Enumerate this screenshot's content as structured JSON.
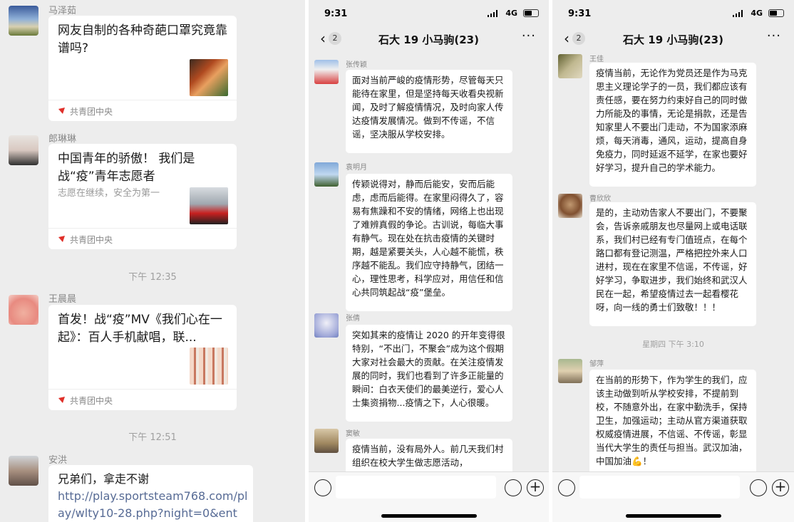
{
  "panel1": {
    "messages": [
      {
        "sender": "马泽茹",
        "title": "网友自制的各种奇葩口罩究竟靠谱吗?",
        "subtitle": "",
        "source": "共青团中央"
      },
      {
        "sender": "郎琳琳",
        "title": "中国青年的骄傲！ 我们是战“疫”青年志愿者",
        "subtitle": "志愿在继续，安全为第一",
        "source": "共青团中央"
      },
      {
        "sender": "王晨晨",
        "title": "首发！战“疫”MV《我们心在一起》：百人手机献唱，联...",
        "subtitle": "",
        "source": "共青团中央"
      }
    ],
    "timestamps": [
      "下午 12:35",
      "下午 12:51"
    ],
    "last": {
      "sender": "安洪",
      "text": "兄弟们，拿走不谢",
      "url": "http://play.sportsteam768.com/play/wlty10-28.php?night=0&ent"
    }
  },
  "phone": {
    "time": "9:31",
    "network": "4G",
    "title": "石大 19 小马驹(23)",
    "badge": "2",
    "more": "···"
  },
  "panel2": {
    "messages": [
      {
        "name": "张传颖",
        "text": "面对当前严峻的疫情形势，尽管每天只能待在家里，但是坚持每天收看央视新闻，及时了解疫情情况，及时向家人传达疫情发展情况。做到不传谣，不信谣，坚决服从学校安排。"
      },
      {
        "name": "袁明月",
        "text": "传颖说得对，静而后能安，安而后能虑，虑而后能得。在家里闷得久了，容易有焦躁和不安的情绪，网络上也出现了难辨真假的争论。古训说，每临大事有静气。现在处在抗击疫情的关键时期，越是紧要关头，人心越不能慌，秩序越不能乱。我们应守持静气，团结一心，理性思考，科学应对，用信任和信心共同筑起战“疫”堡垒。"
      },
      {
        "name": "张倩",
        "text": "突如其来的疫情让 2020 的开年变得很特别，“不出门，不聚会”成为这个假期大家对社会最大的贡献。在关注疫情发展的同时，我们也看到了许多正能量的瞬间：白衣天使们的最美逆行，爱心人士集资捐物...疫情之下，人心很暖。"
      },
      {
        "name": "窦敏",
        "text": "疫情当前，没有局外人。前几天我们村组织在校大学生做志愿活动，"
      }
    ]
  },
  "panel3": {
    "messages": [
      {
        "name": "王佳",
        "text": "疫情当前，无论作为党员还是作为马克思主义理论学子的一员，我们都应该有责任感，要在努力约束好自己的同时做力所能及的事情，无论是捐款，还是告知家里人不要出门走动，不为国家添麻烦，每天消毒，通风，运动，提高自身免疫力，同时延返不延学，在家也要好好学习，提升自己的学术能力。"
      },
      {
        "name": "曹欣欣",
        "text": "是的，主动劝告家人不要出门，不要聚会，告诉亲戚朋友也尽量网上或电话联系，我们村已经有专门值班点，在每个路口都有登记测温，严格把控外来人口进村，现在在家里不信谣，不传谣，好好学习，争取进步，我们始终和武汉人民在一起，希望疫情过去一起看樱花呀，向一线的勇士们致敬！！！"
      },
      {
        "name": "邹萍",
        "text": "在当前的形势下，作为学生的我们，应该主动做到听从学校安排，不提前到校，不随意外出，在家中勤洗手，保持卫生，加强运动；主动从官方渠道获取权威疫情进展，不信谣、不传谣，彰显当代大学生的责任与担当。武汉加油，中国加油💪！"
      }
    ],
    "timestamp": "星期四 下午 3:10"
  }
}
